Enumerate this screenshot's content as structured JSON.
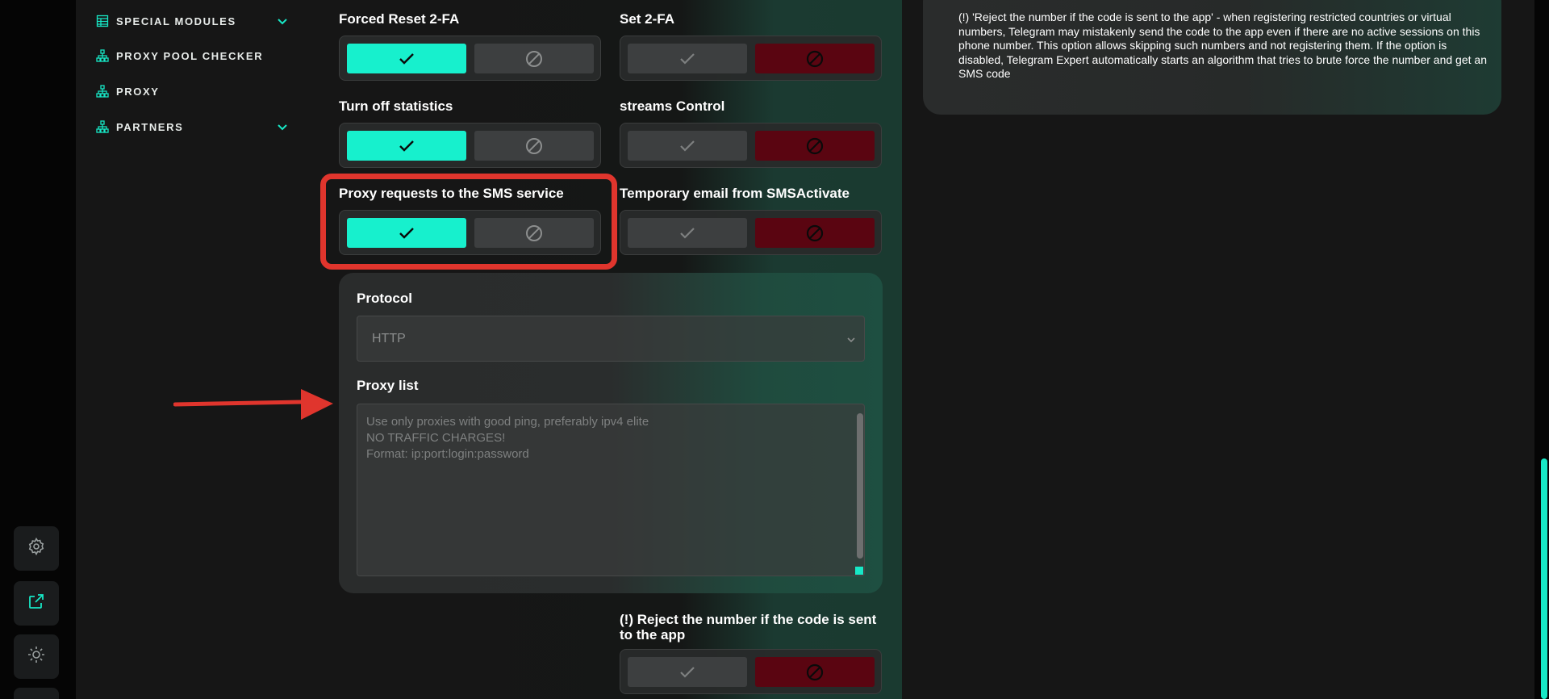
{
  "sidebar": {
    "items": [
      {
        "label": "SPECIAL MODULES",
        "icon": "table-icon",
        "expandable": true
      },
      {
        "label": "PROXY POOL CHECKER",
        "icon": "network-icon",
        "expandable": false
      },
      {
        "label": "PROXY",
        "icon": "network-icon",
        "expandable": false
      },
      {
        "label": "PARTNERS",
        "icon": "network-icon",
        "expandable": true
      }
    ]
  },
  "rail": {
    "buttons": [
      "gear-icon",
      "external-link-icon",
      "sun-icon"
    ]
  },
  "settings": {
    "forced_reset_2fa": {
      "label": "Forced Reset 2-FA",
      "state": "yes"
    },
    "set_2fa": {
      "label": "Set 2-FA",
      "state": "no"
    },
    "turn_off_statistics": {
      "label": "Turn off statistics",
      "state": "yes"
    },
    "streams_control": {
      "label": "streams Control",
      "state": "no"
    },
    "proxy_requests_sms": {
      "label": "Proxy requests to the SMS service",
      "state": "yes"
    },
    "temporary_email": {
      "label": "Temporary email from SMSActivate",
      "state": "no"
    },
    "reject_number": {
      "label": "(!) Reject the number if the code is sent to the app",
      "state": "no"
    }
  },
  "proxy_panel": {
    "protocol_label": "Protocol",
    "protocol_value": "HTTP",
    "proxy_list_label": "Proxy list",
    "proxy_list_placeholder": "Use only proxies with good ping, preferably ipv4 elite\nNO TRAFFIC CHARGES!\nFormat: ip:port:login:password"
  },
  "info": {
    "text": "(!) 'Reject the number if the code is sent to the app' - when registering restricted countries or virtual numbers, Telegram may mistakenly send the code to the app even if there are no active sessions on this phone number. This option allows skipping such numbers and not registering them. If the option is disabled, Telegram Expert automatically starts an algorithm that tries to brute force the number and get an SMS code"
  },
  "colors": {
    "accent": "#17f0cd",
    "danger": "#5a0511",
    "highlight": "#e0352d"
  }
}
